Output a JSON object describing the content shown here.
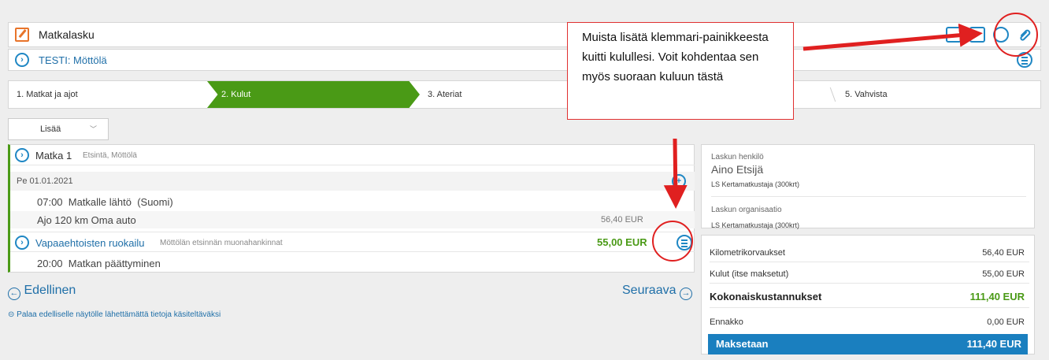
{
  "header": {
    "title": "Matkalasku",
    "subtitle": "TESTI: Möttölä"
  },
  "steps": [
    {
      "label": "1. Matkat ja ajot"
    },
    {
      "label": "2. Kulut"
    },
    {
      "label": "3. Ateriat"
    },
    {
      "label": "5. Vahvista"
    }
  ],
  "add_button": {
    "label": "Lisää"
  },
  "trip": {
    "name": "Matka 1",
    "desc": "Etsintä, Möttölä",
    "date": "Pe 01.01.2021",
    "start": "07:00  Matkalle lähtö  (Suomi)",
    "drive": "Ajo 120 km Oma auto",
    "drive_amount": "56,40 EUR",
    "expense_name": "Vapaaehtoisten ruokailu",
    "expense_desc": "Möttölän etsinnän muonahankinnat",
    "expense_amount": "55,00 EUR",
    "end": "20:00  Matkan päättyminen"
  },
  "nav": {
    "prev": "Edellinen",
    "next": "Seuraava",
    "back_link": "Palaa edelliselle näytölle lähettämättä tietoja käsiteltäväksi"
  },
  "person_panel": {
    "person_label": "Laskun henkilö",
    "person_name": "Aino Etsijä",
    "person_org": "LS Kertamatkustaja (300krt)",
    "org_label": "Laskun organisaatio",
    "org_value": "LS Kertamatkustaja (300krt)"
  },
  "summary": {
    "rows": [
      {
        "label": "Kilometrikorvaukset",
        "value": "56,40 EUR"
      },
      {
        "label": "Kulut (itse maksetut)",
        "value": "55,00 EUR"
      },
      {
        "label": "Kokonaiskustannukset",
        "value": "111,40 EUR"
      },
      {
        "label": "Ennakko",
        "value": "0,00 EUR"
      }
    ],
    "pay_label": "Maksetaan",
    "pay_value": "111,40 EUR"
  },
  "annotation": {
    "text": "Muista lisätä klemmari-painikkeesta kuitti kulullesi. Voit kohdentaa sen myös suoraan kuluun tästä"
  },
  "colors": {
    "accent": "#1f87c4",
    "active_step": "#4a9a16",
    "pay_bar": "#1a7fbf",
    "annotation": "#e02020"
  }
}
